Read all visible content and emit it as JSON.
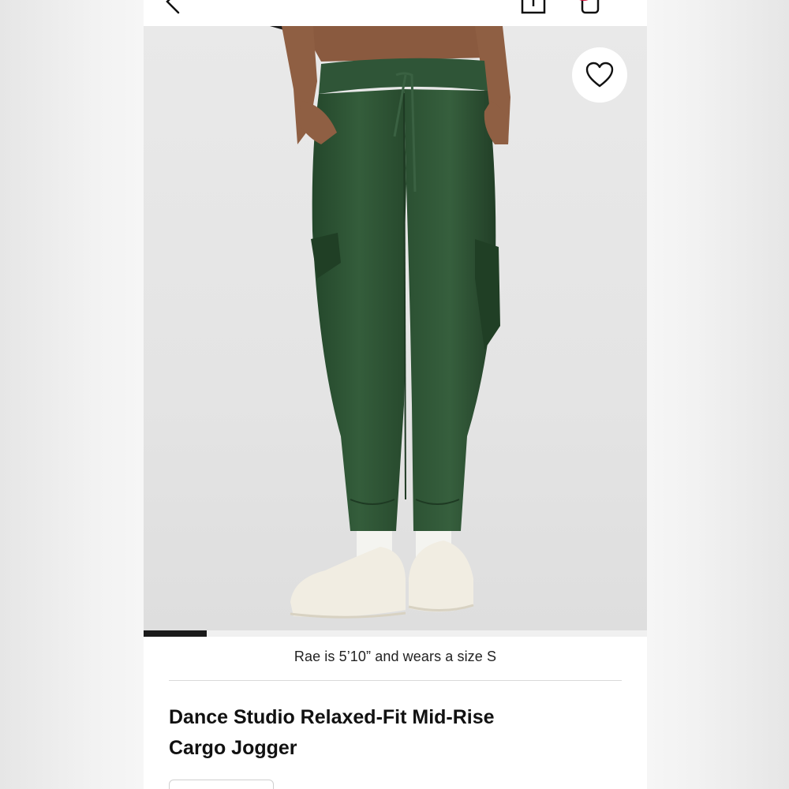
{
  "product": {
    "name": "Dance Studio Relaxed-Fit Mid-Rise Cargo Jogger",
    "model_note": "Rae is 5’10” and wears a size S",
    "image_progress": 0.125
  },
  "icons": {
    "back": "chevron-left-icon",
    "share": "share-icon",
    "cart": "shopping-bag-icon",
    "wishlist": "heart-icon"
  },
  "colors": {
    "cart_badge": "#d6113a",
    "product_green": "#2c5233",
    "progress": "#1a1a1a"
  }
}
